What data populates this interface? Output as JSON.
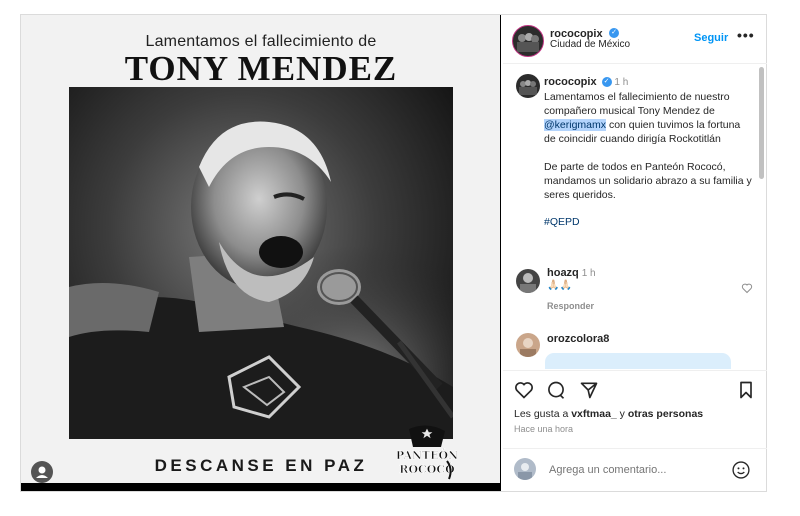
{
  "post_image": {
    "heading_small": "Lamentamos el fallecimiento de",
    "heading_large": "TONY MENDEZ",
    "footer": "DESCANSE EN PAZ",
    "logo_text_top": "PANTEÓN",
    "logo_text_bottom": "ROCOCÓ"
  },
  "header": {
    "username": "rococopix",
    "location": "Ciudad de México",
    "follow_label": "Seguir",
    "more_label": "•••"
  },
  "caption": {
    "username": "rococopix",
    "time": "1 h",
    "text_1": "Lamentamos el fallecimiento de nuestro compañero musical Tony Mendez de",
    "mention": "@kerigmamx",
    "text_2": "con quien tuvimos la fortuna de coincidir cuando dirigía Rockotitlán",
    "text_3": "De parte de todos en Panteón Rococó, mandamos un solidario abrazo a su familia y seres queridos.",
    "hashtag": "#QEPD"
  },
  "comments": [
    {
      "username": "hoazq",
      "time": "1 h",
      "text": "🙏🏻🙏🏻",
      "reply_label": "Responder"
    },
    {
      "username": "orozcolora8"
    }
  ],
  "likes": {
    "prefix": "Les gusta a",
    "user": "vxftmaa_",
    "middle": "y",
    "others": "otras personas",
    "time": "Hace una hora"
  },
  "comment_input": {
    "placeholder": "Agrega un comentario..."
  },
  "icons": [
    "heart-icon",
    "comment-icon",
    "share-icon",
    "bookmark-icon",
    "emoji-icon",
    "verified-icon",
    "user-icon"
  ],
  "colors": {
    "accent": "#0095f6",
    "link": "#00376b",
    "mention_bg": "#b3d4fc"
  }
}
